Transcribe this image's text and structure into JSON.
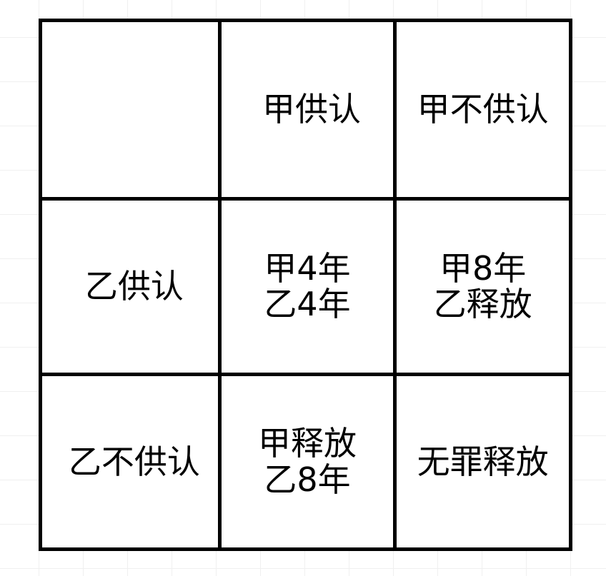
{
  "matrix": {
    "corner": "",
    "col_headers": [
      "甲供认",
      "甲不供认"
    ],
    "row_headers": [
      "乙供认",
      "乙不供认"
    ],
    "outcomes": [
      [
        [
          "甲4年",
          "乙4年"
        ],
        [
          "甲8年",
          "乙释放"
        ]
      ],
      [
        [
          "甲释放",
          "乙8年"
        ],
        [
          "无罪释放"
        ]
      ]
    ]
  }
}
